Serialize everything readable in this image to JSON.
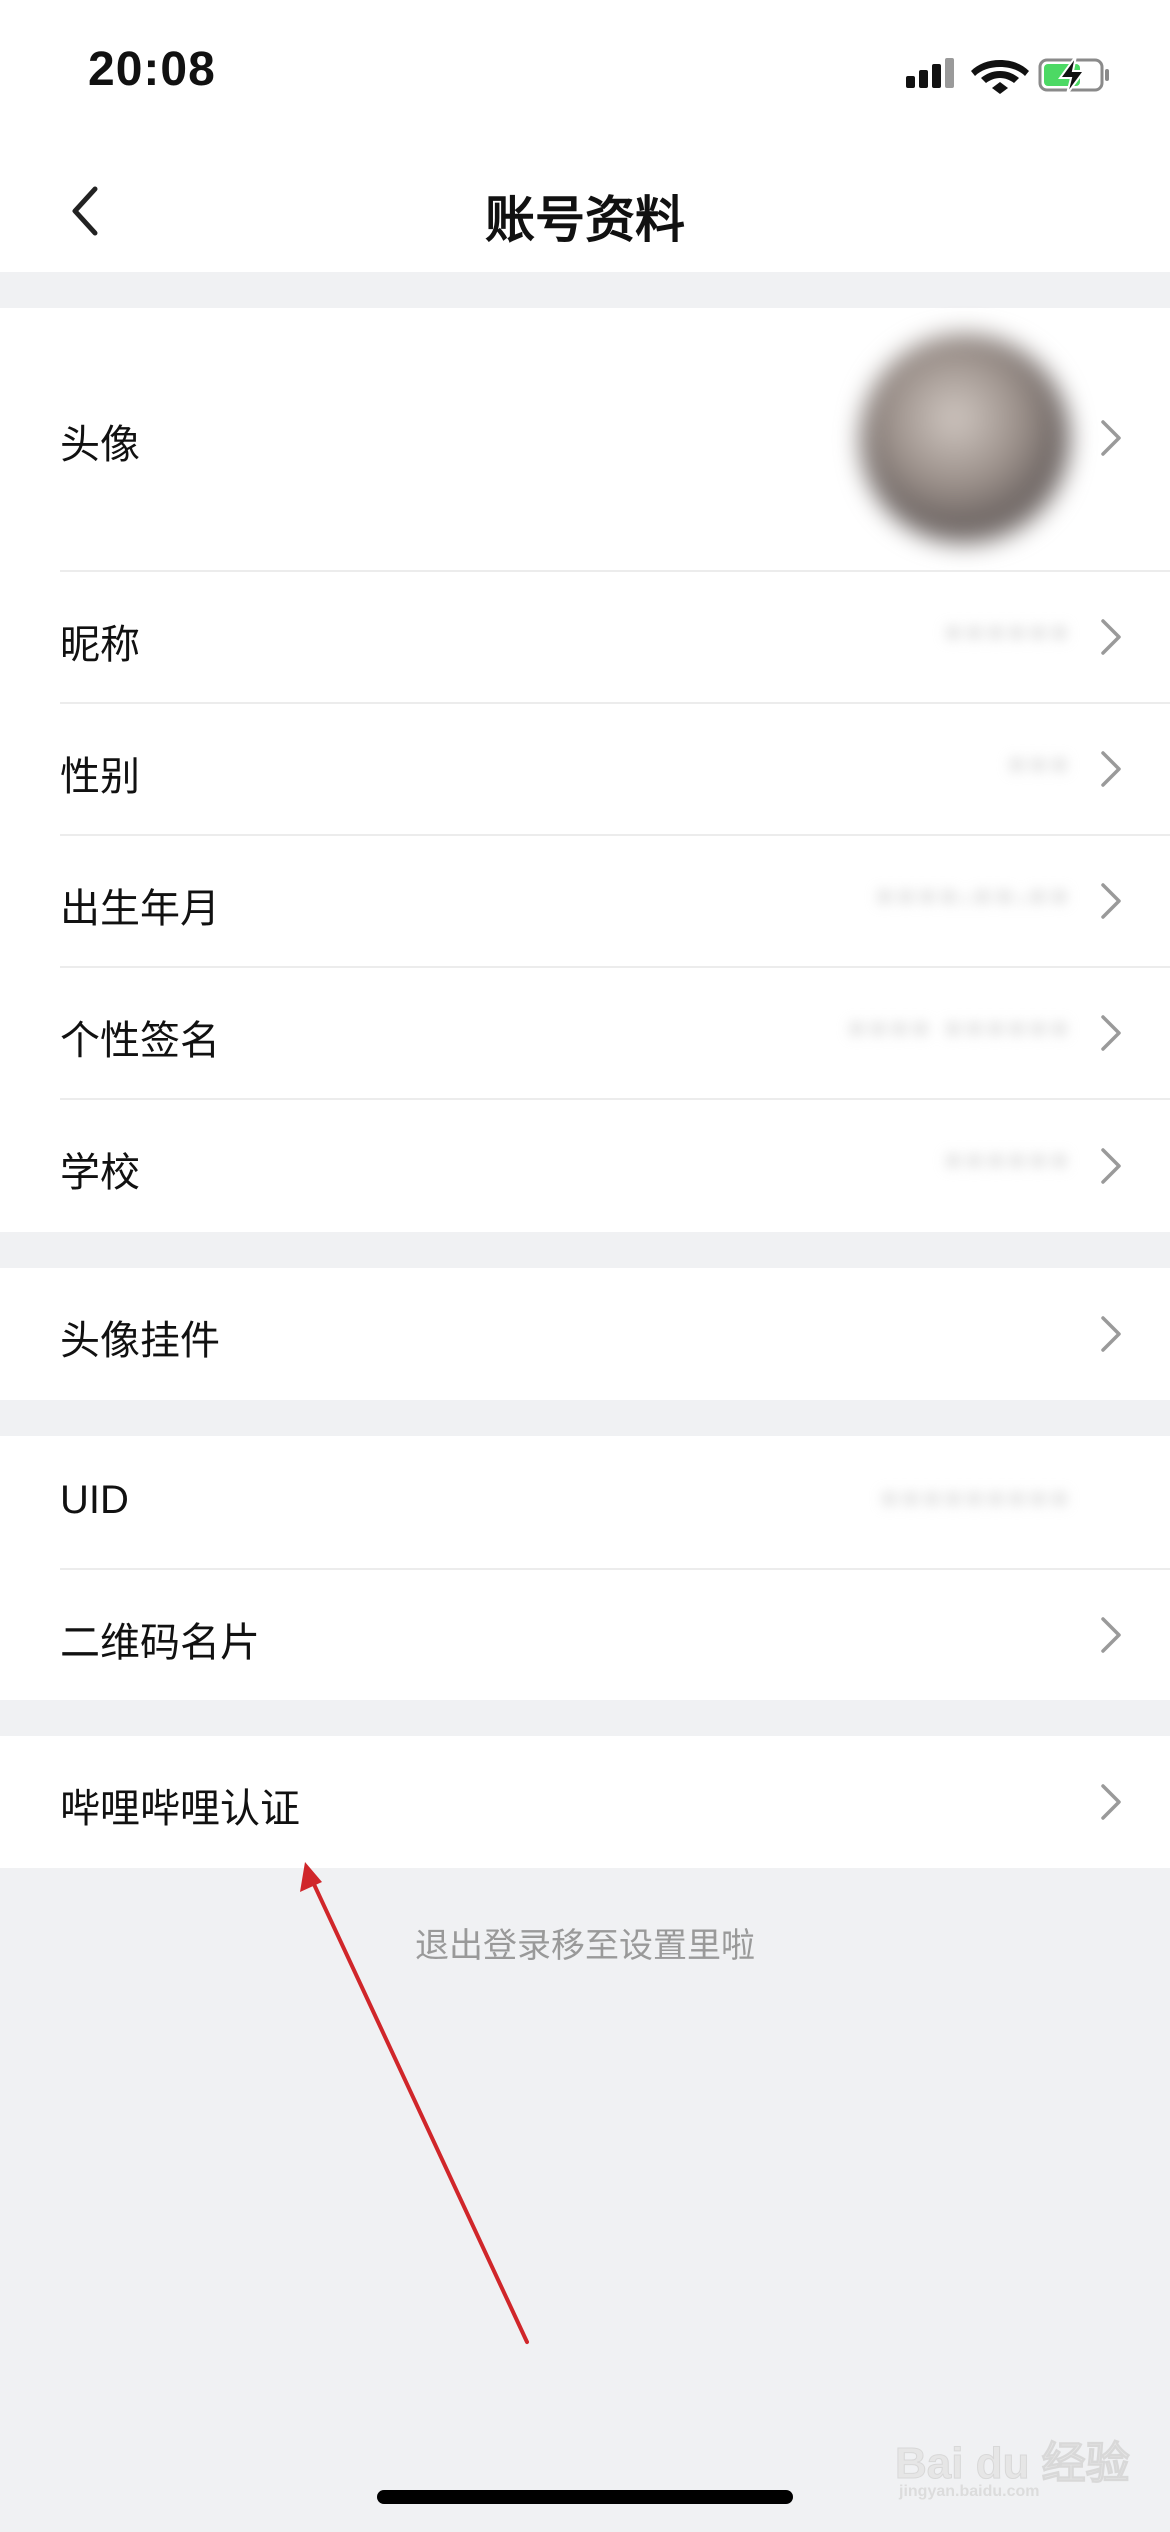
{
  "status_bar": {
    "time": "20:08",
    "icons": [
      "signal-icon",
      "wifi-icon",
      "battery-charging-icon"
    ],
    "battery_color": "#4cd964"
  },
  "nav": {
    "title": "账号资料",
    "back_icon": "chevron-left-icon"
  },
  "profile_section": {
    "rows": [
      {
        "label": "头像",
        "value": ""
      },
      {
        "label": "昵称",
        "value": "••••••"
      },
      {
        "label": "性别",
        "value": "•••"
      },
      {
        "label": "出生年月",
        "value": "••••-••-••"
      },
      {
        "label": "个性签名",
        "value": "•••• ••••••"
      },
      {
        "label": "学校",
        "value": "••••••"
      }
    ]
  },
  "pendant_section": {
    "rows": [
      {
        "label": "头像挂件"
      }
    ]
  },
  "id_section": {
    "rows": [
      {
        "label": "UID",
        "value": "•••••••••"
      },
      {
        "label": "二维码名片"
      }
    ]
  },
  "auth_section": {
    "rows": [
      {
        "label": "哔哩哔哩认证"
      }
    ]
  },
  "footer": {
    "hint": "退出登录移至设置里啦"
  },
  "annotation": {
    "arrow_color": "#d0262a"
  },
  "watermark": {
    "text": "Bai du 经验",
    "sub": "jingyan.baidu.com"
  },
  "colors": {
    "background": "#f0f1f3",
    "card": "#ffffff",
    "divider": "#ececec",
    "hint_text": "#999999"
  }
}
